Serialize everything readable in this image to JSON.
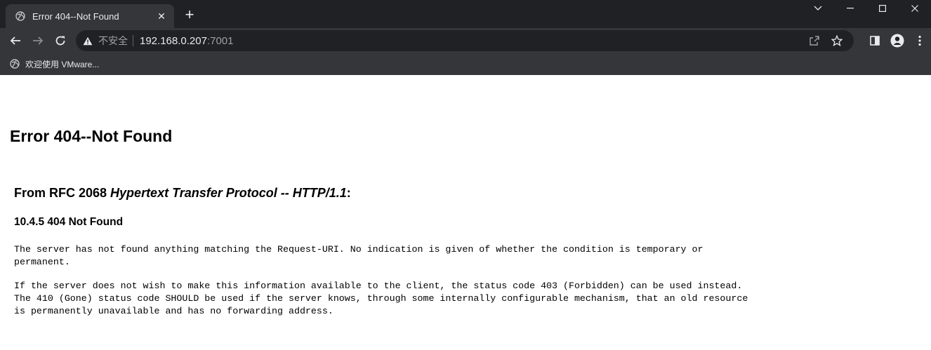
{
  "browser": {
    "tab_title": "Error 404--Not Found",
    "new_tab_label": "+",
    "address": {
      "security_label": "不安全",
      "host": "192.168.0.207",
      "port": ":7001"
    },
    "bookmarks": [
      {
        "label": "欢迎使用 VMware..."
      }
    ]
  },
  "page": {
    "title": "Error 404--Not Found",
    "rfc_heading": {
      "prefix": "From RFC 2068 ",
      "italic": "Hypertext Transfer Protocol -- HTTP/1.1",
      "suffix": ":"
    },
    "section_heading": "10.4.5 404 Not Found",
    "paragraph1": "The server has not found anything matching the Request-URI. No indication is given of whether the condition is temporary or\npermanent.",
    "paragraph2": "If the server does not wish to make this information available to the client, the status code 403 (Forbidden) can be used instead.\nThe 410 (Gone) status code SHOULD be used if the server knows, through some internally configurable mechanism, that an old resource\nis permanently unavailable and has no forwarding address."
  }
}
